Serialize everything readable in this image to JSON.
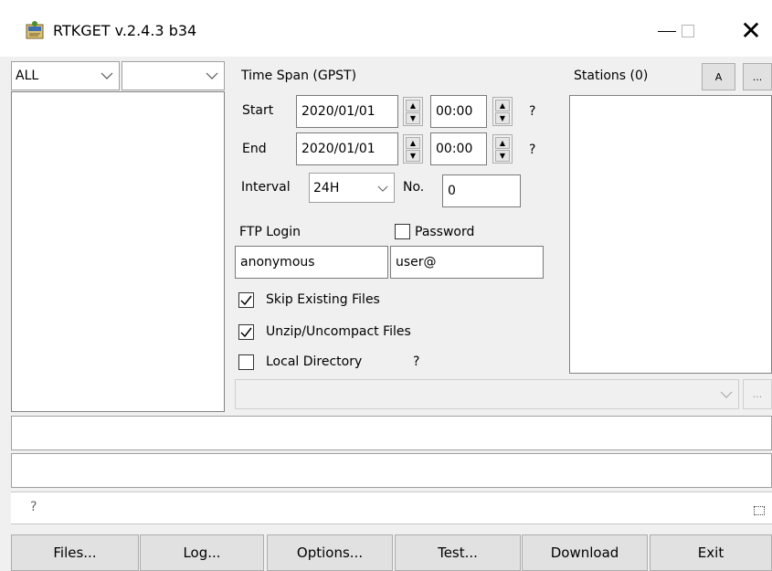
{
  "window": {
    "title": "RTKGET v.2.4.3 b34",
    "minimize_glyph": "—",
    "close_glyph": "✕"
  },
  "left": {
    "type_select": "ALL",
    "subtype_select": ""
  },
  "timespan": {
    "heading": "Time Span (GPST)",
    "start_label": "Start",
    "start_date": "2020/01/01",
    "start_time": "00:00",
    "end_label": "End",
    "end_date": "2020/01/01",
    "end_time": "00:00",
    "help": "?",
    "interval_label": "Interval",
    "interval_value": "24H",
    "no_label": "No.",
    "no_value": "0"
  },
  "ftp": {
    "login_label": "FTP Login",
    "password_label": "Password",
    "password_checked": false,
    "user": "anonymous",
    "password": "user@"
  },
  "options": {
    "skip_existing": "Skip Existing Files",
    "skip_existing_checked": true,
    "unzip": "Unzip/Uncompact Files",
    "unzip_checked": true,
    "local_dir": "Local Directory",
    "local_dir_checked": false,
    "local_dir_help": "?"
  },
  "stations": {
    "label": "Stations (0)",
    "a_button": "A",
    "more_button": "..."
  },
  "directory": {
    "value": "",
    "browse_button": "..."
  },
  "status": {
    "help": "?"
  },
  "buttons": {
    "files": "Files...",
    "log": "Log...",
    "options": "Options...",
    "test": "Test...",
    "download": "Download",
    "exit": "Exit"
  },
  "colors": {
    "panel": "#f0f0f0",
    "field_border": "#7a7a7a",
    "button_face": "#e1e1e1"
  }
}
